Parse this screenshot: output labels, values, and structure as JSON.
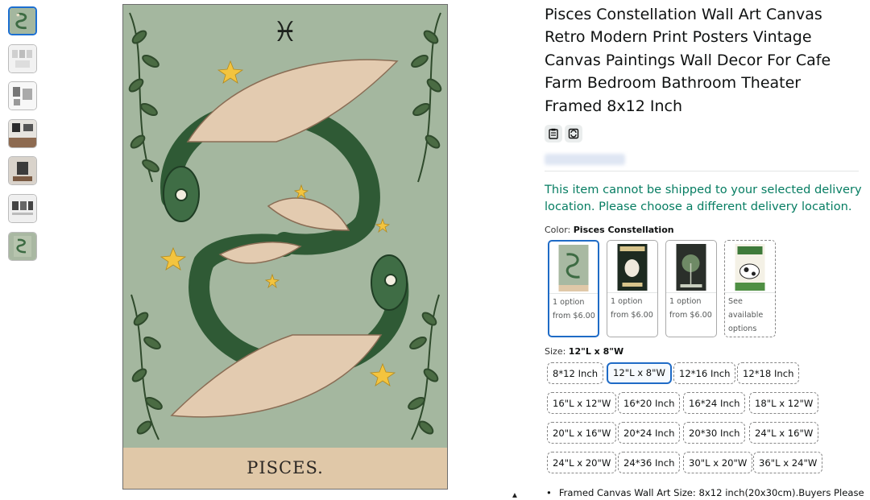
{
  "thumbnails": [
    {
      "icon": "pisces-art-thumb"
    },
    {
      "icon": "multi-print-thumb"
    },
    {
      "icon": "size-chart-thumb"
    },
    {
      "icon": "room-display-thumb"
    },
    {
      "icon": "wall-display-thumb"
    },
    {
      "icon": "frame-set-thumb"
    },
    {
      "icon": "pisces-art-thumb-2"
    }
  ],
  "main_image": {
    "symbol": "♓",
    "caption": "PISCES."
  },
  "product": {
    "title": "Pisces Constellation Wall Art Canvas Retro Modern Print Posters Vintage Canvas Paintings Wall Decor For Cafe Farm Bedroom Bathroom Theater Framed 8x12 Inch",
    "tool_icons": [
      "clipboard-icon",
      "refresh-icon"
    ],
    "delivery_message": "This item cannot be shipped to your selected delivery location. Please choose a different delivery location."
  },
  "color": {
    "label": "Color:",
    "selected": "Pisces Constellation",
    "options": [
      {
        "line1": "1 option",
        "line2": "from $6.00"
      },
      {
        "line1": "1 option",
        "line2": "from $6.00"
      },
      {
        "line1": "1 option",
        "line2": "from $6.00"
      },
      {
        "line1": "See",
        "line2": "available",
        "line3": "options"
      }
    ],
    "accent": "#1f6bc6"
  },
  "size": {
    "label": "Size:",
    "selected": "12\"L x 8\"W",
    "options": [
      "8*12 Inch",
      "12\"L x 8\"W",
      "12*16 Inch",
      "12*18 Inch",
      "16\"L x 12\"W",
      "16*20 Inch",
      "16*24 Inch",
      "18\"L x 12\"W",
      "20\"L x 16\"W",
      "20*24 Inch",
      "20*30 Inch",
      "24\"L x 16\"W",
      "24\"L x 20\"W",
      "24*36 Inch",
      "30\"L x 20\"W",
      "36\"L x 24\"W"
    ]
  },
  "bullets": [
    "Framed Canvas Wall Art Size: 8x12 inch(20x30cm).Buyers Please"
  ],
  "colors": {
    "delivery_green": "#067d62",
    "art_background": "#a4b79f",
    "art_banner": "#e0c8a8"
  }
}
